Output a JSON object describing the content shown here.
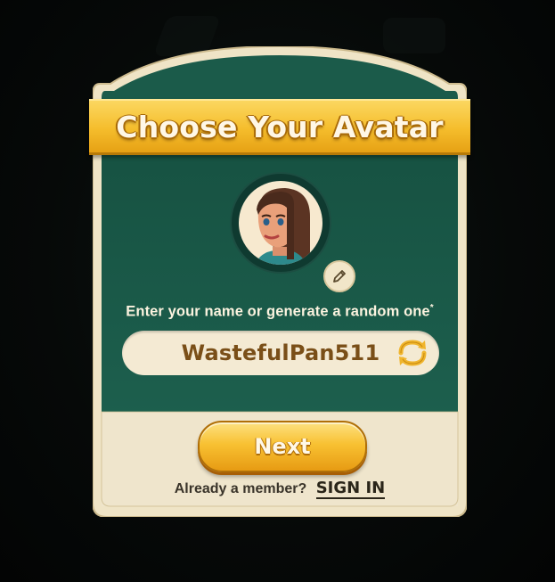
{
  "dialog": {
    "title": "Choose Your Avatar",
    "prompt": "Enter your name or generate a random one",
    "prompt_required_mark": "*",
    "name_value": "WastefulPan511",
    "next_label": "Next",
    "member_text": "Already a member?",
    "signin_label": "SIGN IN"
  },
  "icons": {
    "edit": "pencil-icon",
    "refresh": "refresh-icon",
    "avatar": "avatar-portrait"
  },
  "colors": {
    "panel_green": "#1b5b4a",
    "panel_cream": "#efe5cc",
    "banner_gold": "#f5bd2c",
    "name_text": "#7a4f18"
  }
}
